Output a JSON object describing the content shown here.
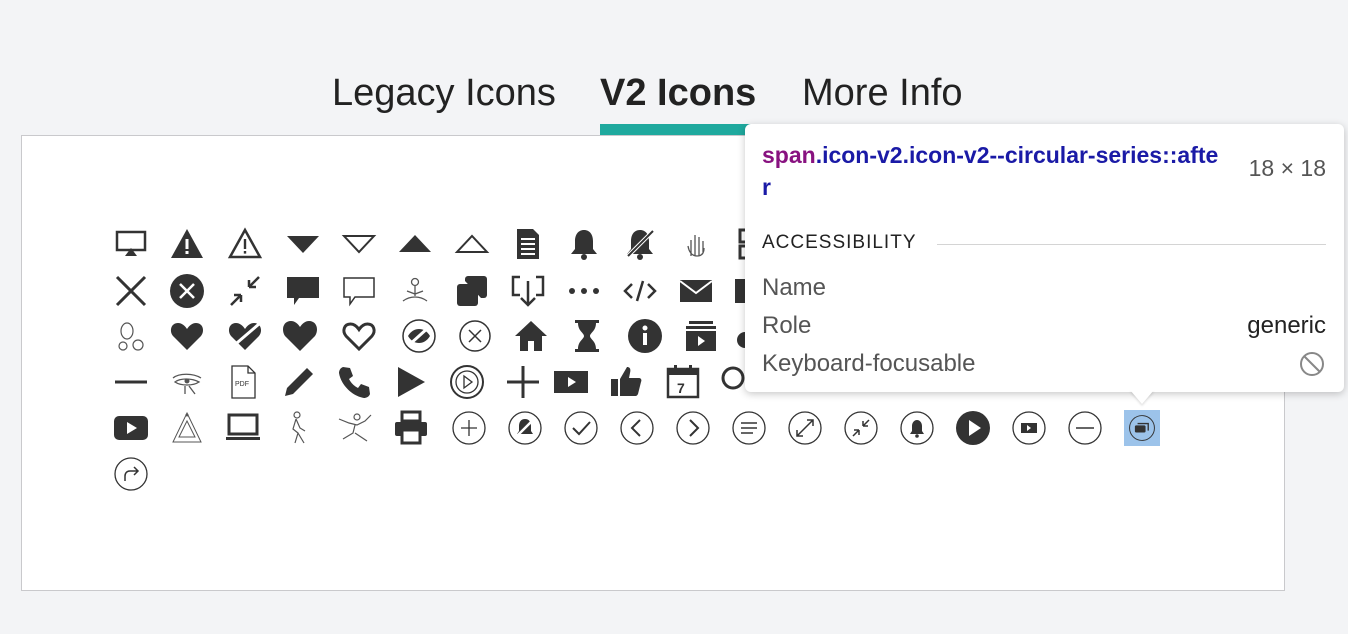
{
  "tabs": [
    {
      "label": "Legacy Icons",
      "active": false
    },
    {
      "label": "V2 Icons",
      "active": true
    },
    {
      "label": "More Info",
      "active": false
    }
  ],
  "colors": {
    "accent": "#1fa99e",
    "selected": "#9cc3ea",
    "tag": "#881280",
    "selector": "#1a1aa6"
  },
  "icon_grid": {
    "rows": [
      [
        "airplay-icon",
        "warning-filled-icon",
        "warning-outline-icon",
        "triangle-down-filled-icon",
        "triangle-down-outline-icon",
        "triangle-up-filled-icon",
        "triangle-up-outline-icon",
        "document-icon",
        "bell-icon",
        "bell-off-icon",
        "hand-wave-icon",
        "grid-icon"
      ],
      [
        "close-icon",
        "circle-close-filled-icon",
        "compress-icon",
        "chat-filled-icon",
        "chat-outline-icon",
        "meditation-icon",
        "copy-icon",
        "download-icon",
        "more-icon",
        "code-icon",
        "mail-icon",
        "archive-icon"
      ],
      [
        "bacteria-icon",
        "heart-filled-icon",
        "heart-broken-icon",
        "heart-large-icon",
        "heart-outline-icon",
        "eye-slash-icon",
        "circle-x-icon",
        "home-icon",
        "hourglass-icon",
        "info-icon",
        "video-stack-icon",
        "chat-small-icon"
      ],
      [
        "minus-icon",
        "eye-of-horus-icon",
        "pdf-icon",
        "pencil-icon",
        "phone-icon",
        "play-icon",
        "play-circle-icon",
        "plus-icon",
        "video-icon",
        "thumbs-up-icon",
        "calendar-icon",
        "search-icon"
      ],
      [
        "youtube-icon",
        "triangle-logo-icon",
        "laptop-icon",
        "hiker-icon",
        "yoga-icon",
        "printer-icon",
        "circle-plus-icon",
        "circle-bell-off-icon",
        "circle-check-icon",
        "circle-chevron-left-icon",
        "circle-chevron-right-icon",
        "circle-list-icon",
        "circle-expand-icon",
        "circle-compress-icon",
        "circle-bell-icon",
        "circle-play-filled-icon",
        "circle-video-icon",
        "circle-minus-icon",
        "circular-series-icon"
      ],
      [
        "circle-redo-icon"
      ]
    ]
  },
  "inspector": {
    "tag": "span",
    "selector": ".icon-v2.icon-v2--circular-series::after",
    "dims": "18 × 18",
    "section": "ACCESSIBILITY",
    "rows": [
      {
        "label": "Name",
        "value": ""
      },
      {
        "label": "Role",
        "value": "generic"
      },
      {
        "label": "Keyboard-focusable",
        "value": ""
      }
    ],
    "not_allowed_icon": "no-entry-icon"
  }
}
